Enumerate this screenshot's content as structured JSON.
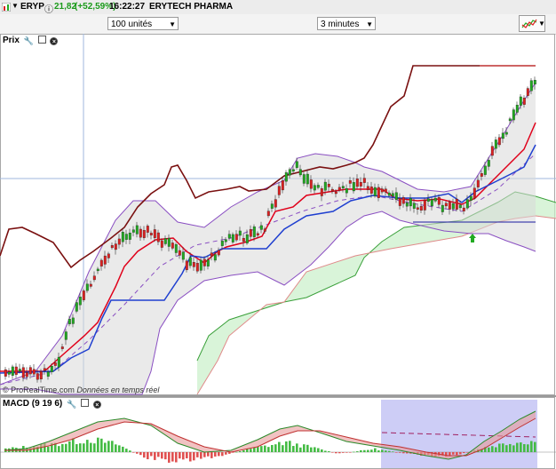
{
  "header": {
    "symbol": "ERYP",
    "price": "21,82",
    "change": "(+52,59%)",
    "time": "16:22:27",
    "name": "ERYTECH PHARMA"
  },
  "controls": {
    "units_select": "100 unités",
    "interval_select": "3 minutes"
  },
  "price_panel": {
    "label": "Prix",
    "watermark_brand": "© ProRealTime.com",
    "watermark_text": "Données en temps réel"
  },
  "macd_panel": {
    "label": "MACD (9 19 6)"
  },
  "colors": {
    "up_candle": "#22aa22",
    "down_candle": "#dd2222",
    "chikou": "#7a1010",
    "tenkan": "#e0001a",
    "kijun": "#1f3fd0",
    "bollinger": "#8a4fc2",
    "cloud": "#c9efc9",
    "change_green": "#1a9a1a"
  },
  "icons": [
    "wrench-icon",
    "window-icon",
    "close-icon",
    "chart-type-icon",
    "up-arrow-icon",
    "flag-icon"
  ]
}
